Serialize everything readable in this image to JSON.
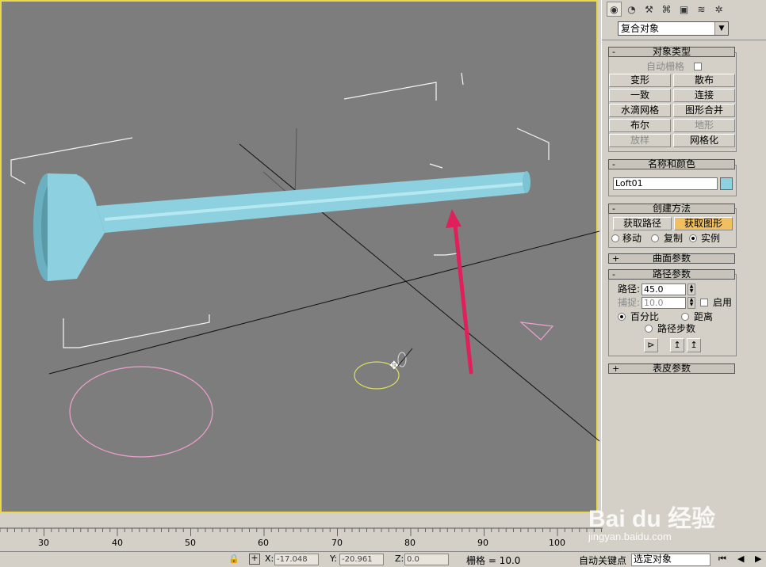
{
  "command_panel": {
    "tabs": [
      "create-tab",
      "modify-tab",
      "hierarchy-tab",
      "motion-tab",
      "display-tab",
      "utilities-tab",
      "extra-tab"
    ],
    "category_dropdown": "复合对象",
    "object_type": {
      "title": "对象类型",
      "autogrid_label": "自动栅格",
      "buttons": [
        {
          "label": "变形",
          "enabled": true
        },
        {
          "label": "散布",
          "enabled": true
        },
        {
          "label": "一致",
          "enabled": true
        },
        {
          "label": "连接",
          "enabled": true
        },
        {
          "label": "水滴网格",
          "enabled": true
        },
        {
          "label": "图形合并",
          "enabled": true
        },
        {
          "label": "布尔",
          "enabled": true
        },
        {
          "label": "地形",
          "enabled": false
        },
        {
          "label": "放样",
          "enabled": false
        },
        {
          "label": "网格化",
          "enabled": true
        }
      ]
    },
    "name_color": {
      "title": "名称和颜色",
      "name_value": "Loft01",
      "color": "#8dd0e0"
    },
    "creation_method": {
      "title": "创建方法",
      "get_path_label": "获取路径",
      "get_shape_label": "获取图形",
      "move_label": "移动",
      "copy_label": "复制",
      "instance_label": "实例"
    },
    "surface_params": {
      "title": "曲面参数"
    },
    "path_params": {
      "title": "路径参数",
      "path_label": "路径:",
      "path_value": "45.0",
      "snap_label": "捕捉:",
      "snap_value": "10.0",
      "enable_label": "启用",
      "percentage_label": "百分比",
      "distance_label": "距离",
      "path_steps_label": "路径步数"
    },
    "skin_params": {
      "title": "表皮参数"
    }
  },
  "timeline": {
    "ticks": [
      "30",
      "40",
      "50",
      "60",
      "70",
      "80",
      "90",
      "100"
    ]
  },
  "status_bar": {
    "x_label": "X:",
    "x_value": "-17.048",
    "y_label": "Y:",
    "y_value": "-20.961",
    "z_label": "Z:",
    "z_value": "0.0",
    "grid_text": "栅格 = 10.0",
    "auto_key_label": "自动关键点",
    "selected_object": "选定对象"
  },
  "watermark": {
    "brand": "Bai du 经验",
    "url": "jingyan.baidu.com"
  },
  "colors": {
    "viewport_bg": "#7d7d7d",
    "viewport_border": "#e8d84a",
    "loft_object": "#8dd0e0",
    "annotation_arrow": "#e0205a",
    "shape_circle_pink": "#f0a0d0",
    "shape_circle_yellow": "#e0e060"
  }
}
